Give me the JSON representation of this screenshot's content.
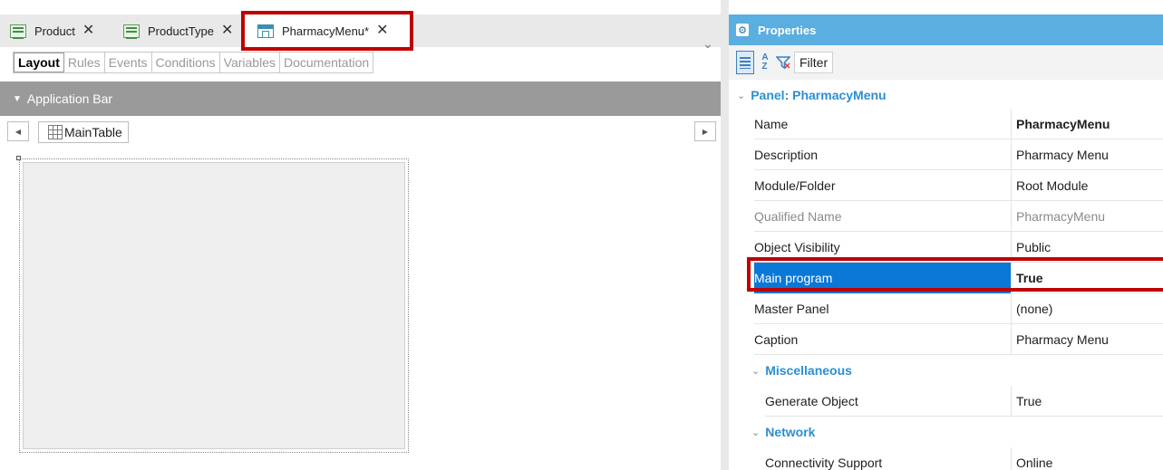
{
  "editor": {
    "tabs": [
      {
        "label": "Product",
        "close": "✕"
      },
      {
        "label": "ProductType",
        "close": "✕"
      },
      {
        "label": "PharmacyMenu",
        "modified": "*",
        "close": "✕"
      }
    ],
    "overflow_icon": "chevron-down-icon",
    "subtabs": [
      "Layout",
      "Rules",
      "Events",
      "Conditions",
      "Variables",
      "Documentation"
    ],
    "active_subtab": "Layout",
    "app_bar_label": "Application Bar",
    "main_table_label": "MainTable"
  },
  "properties": {
    "title": "Properties",
    "toolbar": {
      "filter_label": "Filter",
      "alpha_top": "A",
      "alpha_bottom": "Z"
    },
    "section_title": "Panel: PharmacyMenu",
    "rows": [
      {
        "name": "Name",
        "value": "PharmacyMenu"
      },
      {
        "name": "Description",
        "value": "Pharmacy Menu"
      },
      {
        "name": "Module/Folder",
        "value": "Root Module"
      },
      {
        "name": "Qualified Name",
        "value": "PharmacyMenu"
      },
      {
        "name": "Object Visibility",
        "value": "Public"
      },
      {
        "name": "Main program",
        "value": "True"
      },
      {
        "name": "Master Panel",
        "value": "(none)"
      },
      {
        "name": "Caption",
        "value": "Pharmacy Menu"
      }
    ],
    "groups": [
      {
        "title": "Miscellaneous",
        "rows": [
          {
            "name": "Generate Object",
            "value": "True"
          }
        ]
      },
      {
        "title": "Network",
        "rows": [
          {
            "name": "Connectivity Support",
            "value": "Online"
          }
        ]
      }
    ]
  },
  "colors": {
    "highlight_border": "#c00000",
    "properties_header": "#5aaee0",
    "selected_row": "#0a78d7",
    "group_text": "#2b8fd3"
  }
}
